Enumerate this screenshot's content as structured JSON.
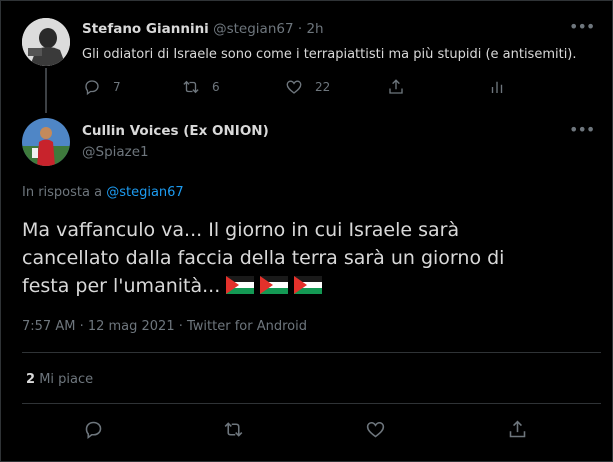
{
  "parent_tweet": {
    "author_name": "Stefano Giannini",
    "handle": "@stegian67",
    "separator": "·",
    "time": "2h",
    "text": "Gli odiatori di Israele sono come i terrapiattisti ma più stupidi (e antisemiti).",
    "reply_count": "7",
    "retweet_count": "6",
    "like_count": "22"
  },
  "main_tweet": {
    "author_name": "Cullin Voices (Ex ONION)",
    "handle": "@Spiaze1",
    "reply_prefix": "In risposta a",
    "reply_to": "@stegian67",
    "text_lines": [
      "Ma vaffanculo va... Il giorno in cui Israele sarà",
      "cancellato dalla faccia della terra sarà un giorno di",
      "festa per l'umanità..."
    ],
    "flag_emojis": [
      "palestine-flag",
      "palestine-flag",
      "palestine-flag"
    ],
    "timestamp": "7:57 AM · 12 mag 2021 · Twitter for Android",
    "likes_count": "2",
    "likes_label": "Mi piace"
  },
  "colors": {
    "background": "#000000",
    "text": "#d9d9d9",
    "muted": "#6e767d",
    "link": "#1d9bf0",
    "divider": "#2f3336",
    "flag_green": "#149954",
    "flag_red": "#e4312b"
  }
}
